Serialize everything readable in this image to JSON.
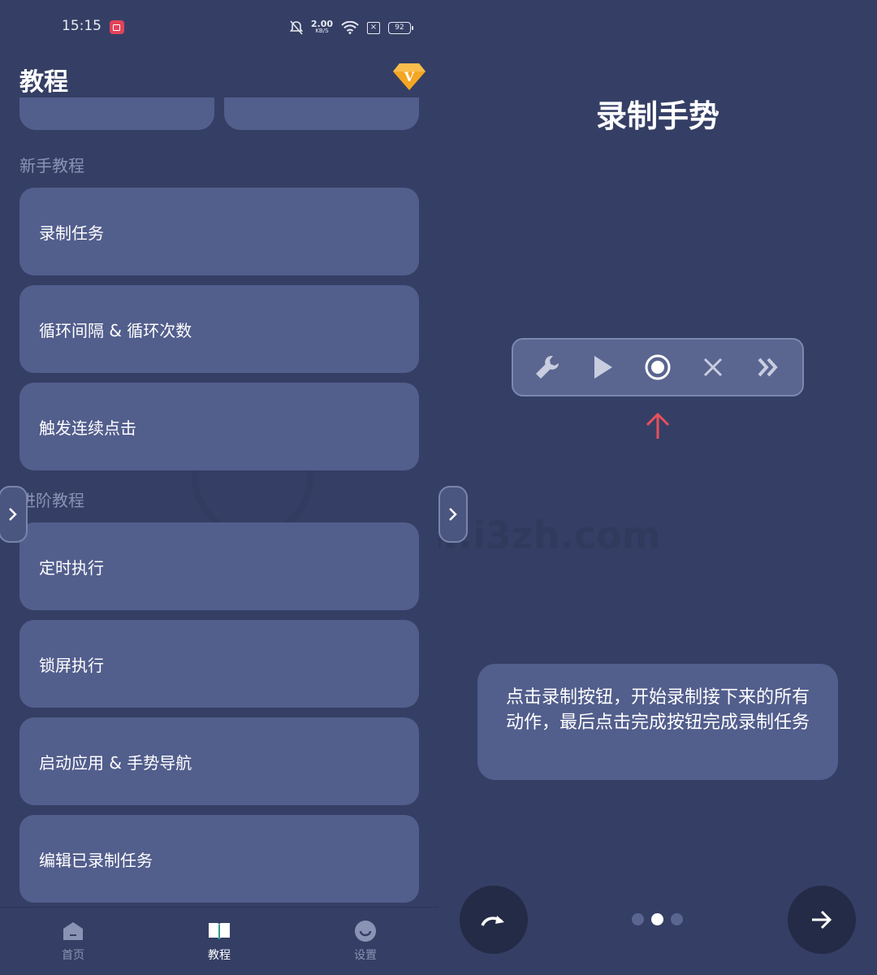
{
  "status_bar": {
    "time": "15:15",
    "net_speed": "2.00",
    "net_unit": "KB/S",
    "battery": "92"
  },
  "left": {
    "page_title": "教程",
    "sections": {
      "beginner": "新手教程",
      "advanced": "进阶教程"
    },
    "beginner_items": [
      "录制任务",
      "循环间隔 & 循环次数",
      "触发连续点击"
    ],
    "advanced_items": [
      "定时执行",
      "锁屏执行",
      "启动应用 & 手势导航",
      "编辑已录制任务"
    ],
    "watermark": "www.i3zh.com",
    "bottom_nav": [
      {
        "label": "首页",
        "icon": "home-icon"
      },
      {
        "label": "教程",
        "icon": "book-icon"
      },
      {
        "label": "设置",
        "icon": "smile-icon"
      }
    ]
  },
  "right": {
    "title": "录制手势",
    "toolbar": [
      "wrench-icon",
      "play-icon",
      "record-icon",
      "close-icon",
      "double-chevron-icon"
    ],
    "tip": "点击录制按钮，开始录制接下来的所有动作，最后点击完成按钮完成录制任务",
    "page_count": 3,
    "current_page": 2
  },
  "colors": {
    "background": "#353f65",
    "card": "#525e8c",
    "accent_red": "#e8505b",
    "vip_orange": "#f5a623"
  }
}
